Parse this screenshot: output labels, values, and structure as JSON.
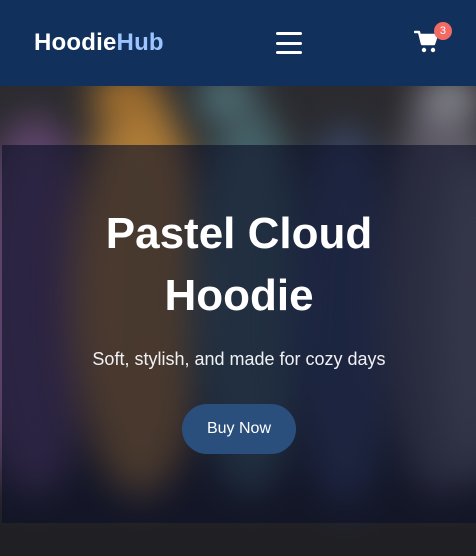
{
  "header": {
    "logo_main": "Hoodie",
    "logo_accent": "Hub",
    "cart_count": "3"
  },
  "hero": {
    "title": "Pastel Cloud Hoodie",
    "subtitle": "Soft, stylish, and made for cozy days",
    "cta_label": "Buy Now"
  },
  "colors": {
    "header_bg": "#11305b",
    "logo_accent": "#9cc4ff",
    "badge": "#f16a63",
    "button": "#2b4f7c"
  },
  "icons": [
    "menu-icon",
    "cart-icon"
  ]
}
